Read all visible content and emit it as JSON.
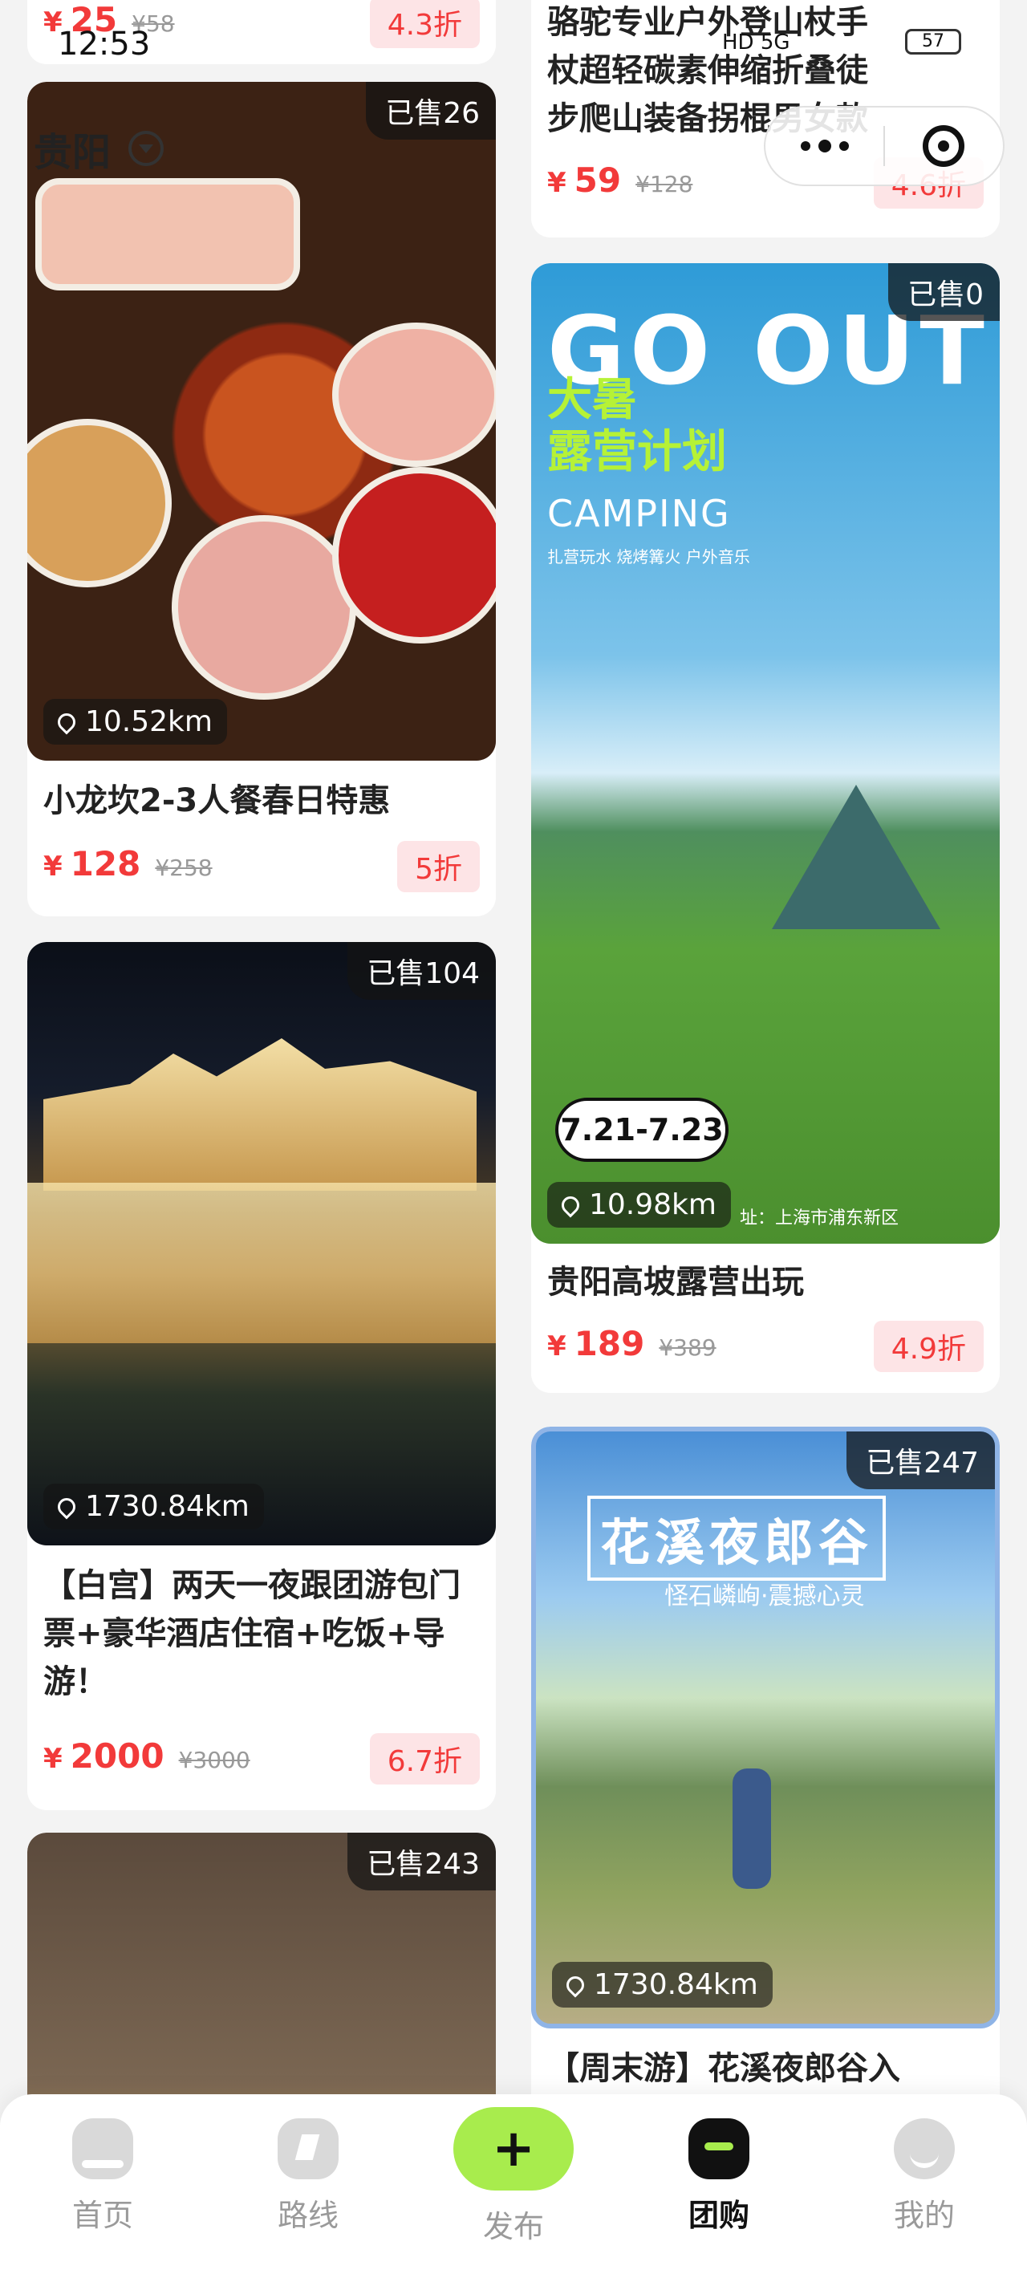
{
  "status_bar": {
    "time": "12:53",
    "network": "HD 5G",
    "battery": "57"
  },
  "header": {
    "city": "贵阳"
  },
  "left_column": [
    {
      "partial": true,
      "price": "25",
      "orig": "¥58",
      "discount": "4.3折"
    },
    {
      "sold": "已售26",
      "distance": "10.52km",
      "title": "小龙坎2-3人餐春日特惠",
      "price": "128",
      "orig": "¥258",
      "discount": "5折"
    },
    {
      "sold": "已售104",
      "distance": "1730.84km",
      "title": "【白宫】两天一夜跟团游包门票+豪华酒店住宿+吃饭+导游！",
      "price": "2000",
      "orig": "¥3000",
      "discount": "6.7折"
    },
    {
      "sold": "已售243"
    }
  ],
  "right_column": [
    {
      "partial": true,
      "title": "骆驼专业户外登山杖手杖超轻碳素伸缩折叠徒步爬山装备拐棍男女款",
      "price": "59",
      "orig": "¥128",
      "discount": "4.6折"
    },
    {
      "sold": "已售0",
      "distance": "10.98km",
      "title": "贵阳高坡露营出玩",
      "price": "189",
      "orig": "¥389",
      "discount": "4.9折",
      "poster": {
        "headline": "GO OUT",
        "sub1": "大暑",
        "sub2": "露营计划",
        "camping": "CAMPING",
        "tag": "扎营玩水 烧烤篝火 户外音乐",
        "dates": "7.21-7.23",
        "address": "址：上海市浦东新区"
      }
    },
    {
      "sold": "已售247",
      "distance": "1730.84km",
      "title": "【周末游】花溪夜郎谷入",
      "poster": {
        "headline": "花溪夜郎谷",
        "sub": "怪石嶙峋·震撼心灵"
      }
    }
  ],
  "currency": "¥",
  "tabbar": [
    {
      "label": "首页",
      "icon": "home-icon"
    },
    {
      "label": "路线",
      "icon": "route-icon"
    },
    {
      "label": "发布",
      "icon": "plus-icon"
    },
    {
      "label": "团购",
      "icon": "group-buy-icon",
      "active": true
    },
    {
      "label": "我的",
      "icon": "profile-icon"
    }
  ]
}
